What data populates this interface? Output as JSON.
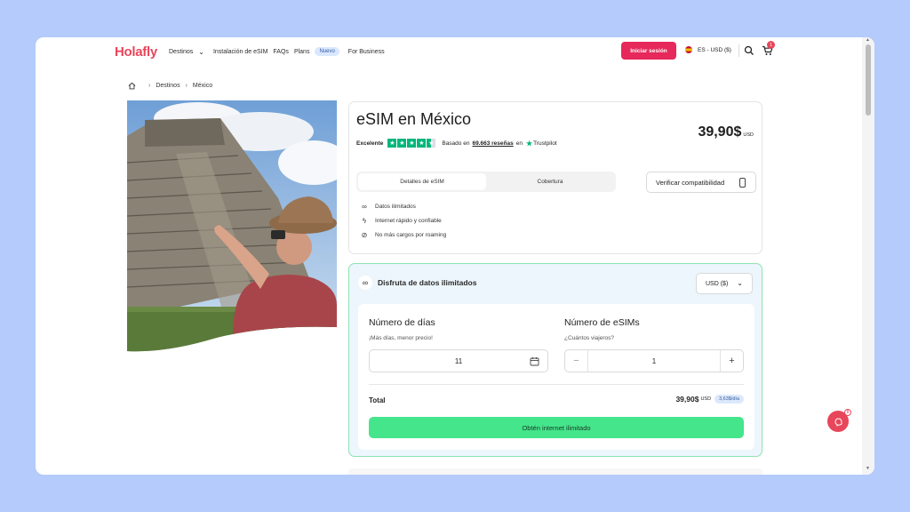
{
  "brand": {
    "logo": "Holafly",
    "accent": "#e8465b"
  },
  "nav": {
    "items": [
      {
        "label": "Destinos"
      },
      {
        "label": "Instalación de eSIM"
      },
      {
        "label": "FAQs"
      },
      {
        "label": "Plans"
      },
      {
        "label": "For Business"
      }
    ],
    "new_badge": "Nuevo",
    "login": "Iniciar sesión",
    "locale": "ES - USD ($)",
    "cart_count": "1"
  },
  "breadcrumb": {
    "items": [
      "Destinos",
      "México"
    ]
  },
  "product": {
    "title": "eSIM en México",
    "price": "39,90$",
    "currency": "USD",
    "rating": {
      "label": "Excelente",
      "stars": 4.5,
      "reviews_prefix": "Basado en",
      "reviews_link": "69.663 reseñas",
      "reviews_suffix": "en",
      "provider": "Trustpilot"
    },
    "tabs": [
      {
        "label": "Detalles de eSIM",
        "active": true
      },
      {
        "label": "Cobertura",
        "active": false
      }
    ],
    "verify_button": "Verificar compatibilidad",
    "features": [
      {
        "icon": "infinity-icon",
        "text": "Datos ilimitados"
      },
      {
        "icon": "lightning-icon",
        "text": "Internet rápido y confiable"
      },
      {
        "icon": "no-roaming-icon",
        "text": "No más cargos por roaming"
      }
    ]
  },
  "plan": {
    "heading": "Disfruta de datos ilimitados",
    "currency_select": "USD ($)",
    "days_label": "Número de días",
    "days_hint": "¡Más días, menor precio!",
    "days_value": "11",
    "esims_label": "Número de eSIMs",
    "esims_hint": "¿Cuántos viajeros?",
    "esims_value": "1",
    "total_label": "Total",
    "total_value": "39,90$",
    "total_currency": "USD",
    "per_day": "3,63$/día",
    "cta": "Obtén internet ilimitado"
  },
  "chat": {
    "badge": "8"
  }
}
